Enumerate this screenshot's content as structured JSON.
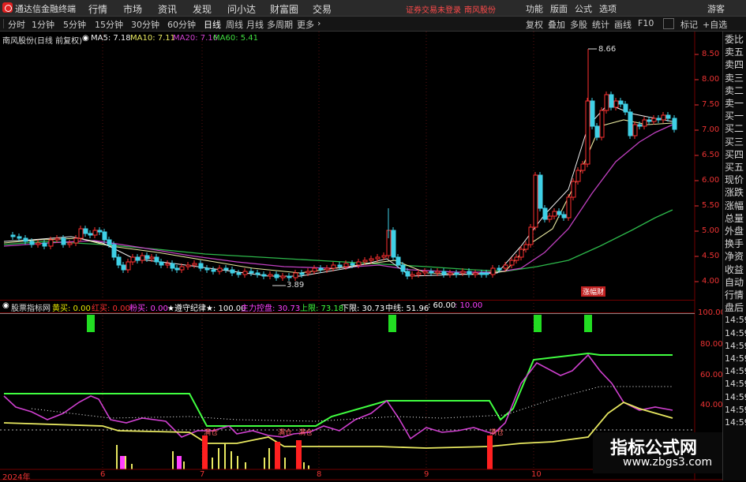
{
  "titlebar": {
    "app_title": "通达信金融终端",
    "menus": [
      "行情",
      "市场",
      "资讯",
      "发现",
      "问小达",
      "财富圈",
      "交易"
    ],
    "notice": "证券交易未登录",
    "stock_tag": "南风股份",
    "right_menus": [
      "功能",
      "版面",
      "公式",
      "选项"
    ],
    "guest": "游客"
  },
  "toolbar": {
    "periods": [
      "分时",
      "1分钟",
      "5分钟",
      "15分钟",
      "30分钟",
      "60分钟",
      "日线",
      "周线",
      "月线",
      "多周期",
      "更多"
    ],
    "active_period": "日线",
    "right": [
      "复权",
      "叠加",
      "多股",
      "统计",
      "画线",
      "F10",
      "标记",
      "+自选"
    ]
  },
  "chart_info": {
    "stock": "南风股份(日线 前复权)",
    "ma5": "MA5: 7.18",
    "ma10": "MA10: 7.11",
    "ma20": "MA20: 7.16",
    "ma60": "MA60: 5.41",
    "max_label": "8.66",
    "min_label": "3.89",
    "price_ticks": [
      "8.50",
      "8.00",
      "7.50",
      "7.00",
      "6.50",
      "6.00",
      "5.50",
      "5.00",
      "4.50",
      "4.00"
    ],
    "event_badge": "涨幅财"
  },
  "indicator_header": {
    "name": "股票指标网",
    "items": [
      {
        "label": "黄买: 0.00",
        "color": "#e6e600"
      },
      {
        "label": "红买: 0.00",
        "color": "#ff3030"
      },
      {
        "label": "粉买: 0.00",
        "color": "#ff40ff"
      },
      {
        "label": "★遵守纪律★: 100.00",
        "color": "#ffffff"
      },
      {
        "label": "主力控盘: 30.73",
        "color": "#ff40ff"
      },
      {
        "label": "上限: 73.18",
        "color": "#40ff40"
      },
      {
        "label": "下限: 30.73",
        "color": "#ffffff"
      },
      {
        "label": "中线: 51.96",
        "color": "#ffffff"
      },
      {
        "label": ": 60.00",
        "color": "#ffffff"
      },
      {
        "label": ": 10.00",
        "color": "#ff40ff"
      }
    ],
    "ticks": [
      "100.00",
      "80.00",
      "60.00",
      "40.00"
    ],
    "buy_label": "满仓"
  },
  "right_panel": {
    "items": [
      "委比",
      "卖五",
      "卖四",
      "卖三",
      "卖二",
      "卖一",
      "买一",
      "买二",
      "买三",
      "买四",
      "买五",
      "现价",
      "涨跌",
      "涨幅",
      "总量",
      "外盘",
      "换手",
      "净资",
      "收益",
      "自动",
      "行情",
      "盘后",
      "14:59",
      "14:59",
      "14:59",
      "14:59",
      "14:59",
      "14:59",
      "14:59",
      "14:59",
      "14:59"
    ]
  },
  "time_axis": [
    "2024年",
    "6",
    "7",
    "8",
    "9",
    "10"
  ],
  "watermark": {
    "title": "指标公式网",
    "url": "www.zbgs3.com"
  }
}
